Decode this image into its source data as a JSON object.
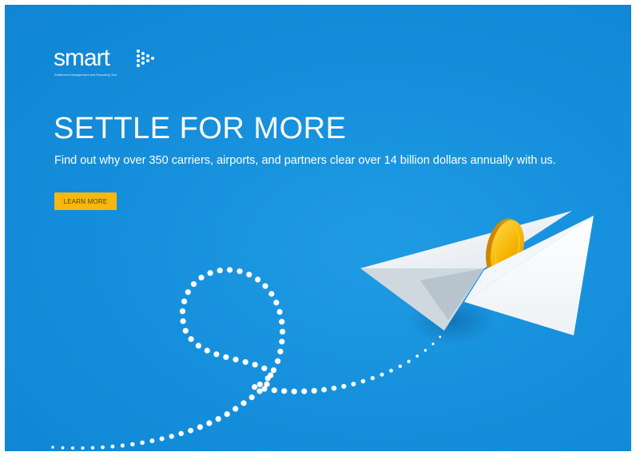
{
  "brand": {
    "name": "smart",
    "tagline": "Settlement Management and Reporting Tool"
  },
  "hero": {
    "headline": "SETTLE FOR MORE",
    "subhead": "Find out why over 350 carriers, airports, and partners clear over 14 billion dollars annually with us.",
    "cta_label": "LEARN MORE"
  },
  "colors": {
    "background": "#1690dc",
    "accent": "#f6b80f",
    "text": "#ffffff"
  },
  "illustration": {
    "plane": "paper-airplane",
    "coin": "gold-coin",
    "trail": "dotted-loop-trail"
  }
}
